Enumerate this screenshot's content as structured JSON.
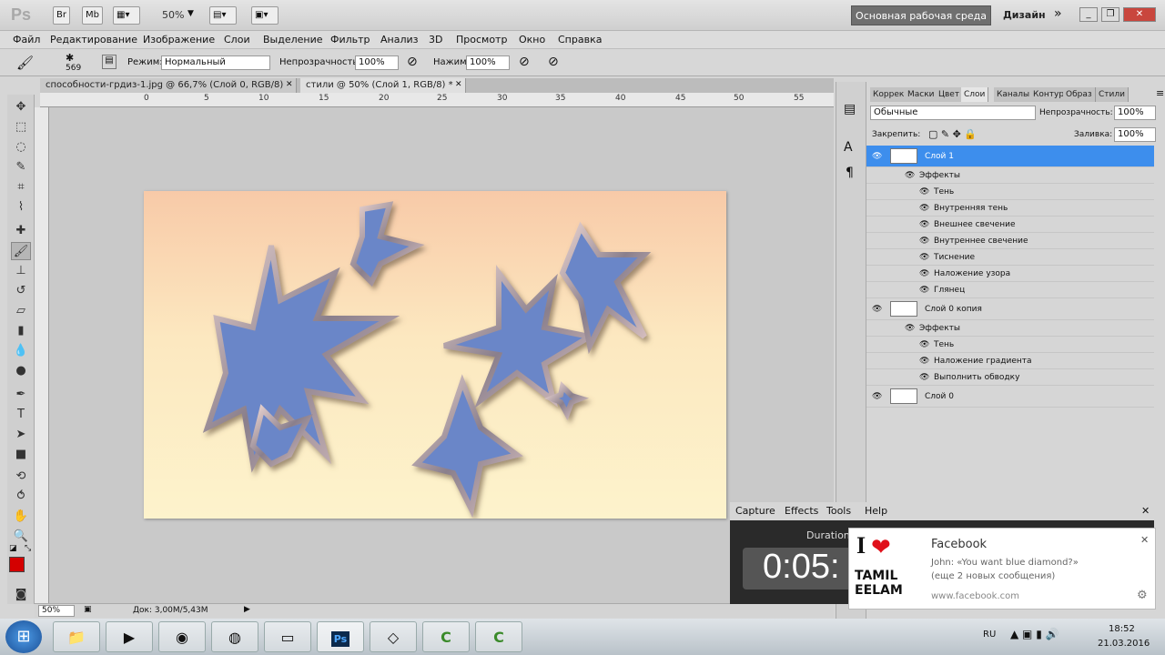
{
  "app": {
    "logo": "Ps",
    "zoom": "50%",
    "workspace": "Основная рабочая среда",
    "design": "Дизайн",
    "btn_br": "Br",
    "btn_mb": "Mb"
  },
  "menu": [
    "Файл",
    "Редактирование",
    "Изображение",
    "Слои",
    "Выделение",
    "Фильтр",
    "Анализ",
    "3D",
    "Просмотр",
    "Окно",
    "Справка"
  ],
  "options": {
    "brush_size": "569",
    "mode_label": "Режим:",
    "mode_value": "Нормальный",
    "opacity_label": "Непрозрачность:",
    "opacity_value": "100%",
    "pressure_label": "Нажим:",
    "pressure_value": "100%"
  },
  "tabs": [
    {
      "label": "способности-грдиз-1.jpg @ 66,7% (Слой 0, RGB/8) *"
    },
    {
      "label": "стили  @ 50% (Слой 1, RGB/8) *"
    }
  ],
  "ruler_h": [
    "0",
    "5",
    "10",
    "15",
    "20",
    "25",
    "30",
    "35",
    "40",
    "45",
    "50",
    "55"
  ],
  "status": {
    "zoom": "50%",
    "doc": "Док: 3,00M/5,43M"
  },
  "layers_panel": {
    "tabs": [
      "Коррек",
      "Маски",
      "Цвет",
      "Слои",
      "Каналы",
      "Контур",
      "Образ",
      "Стили"
    ],
    "blend": "Обычные",
    "opacity_label": "Непрозрачность:",
    "opacity": "100%",
    "lock_label": "Закрепить:",
    "fill_label": "Заливка:",
    "fill": "100%",
    "rows": [
      {
        "name": "Слой 1",
        "type": "layer",
        "selected": true
      },
      {
        "name": "Эффекты",
        "type": "fx-head"
      },
      {
        "name": "Тень",
        "type": "fx"
      },
      {
        "name": "Внутренняя тень",
        "type": "fx"
      },
      {
        "name": "Внешнее свечение",
        "type": "fx"
      },
      {
        "name": "Внутреннее свечение",
        "type": "fx"
      },
      {
        "name": "Тиснение",
        "type": "fx"
      },
      {
        "name": "Наложение узора",
        "type": "fx"
      },
      {
        "name": "Глянец",
        "type": "fx"
      },
      {
        "name": "Слой 0 копия",
        "type": "layer"
      },
      {
        "name": "Эффекты",
        "type": "fx-head"
      },
      {
        "name": "Тень",
        "type": "fx"
      },
      {
        "name": "Наложение градиента",
        "type": "fx"
      },
      {
        "name": "Выполнить обводку",
        "type": "fx"
      },
      {
        "name": "Слой 0",
        "type": "layer"
      }
    ]
  },
  "capture": {
    "menu": [
      "Capture",
      "Effects",
      "Tools",
      "Help"
    ],
    "duration_label": "Duration",
    "timer": "0:05:"
  },
  "notification": {
    "title": "Facebook",
    "line1": "John: «You want blue diamond?»",
    "line2": "(еще 2 новых сообщения)",
    "link": "www.facebook.com",
    "logo_top": "I",
    "logo_mid": "TAMIL",
    "logo_bot": "EELAM"
  },
  "taskbar": {
    "lang": "RU",
    "time": "18:52",
    "date": "21.03.2016",
    "apps": [
      "folder-icon",
      "media-player-icon",
      "chrome-icon",
      "firefox-icon",
      "notes-icon",
      "photoshop-icon",
      "glass-icon",
      "camtasia-icon",
      "camtasia-recorder-icon"
    ]
  },
  "colors": {
    "selected_layer": "#3d8eed",
    "fg_color": "#d40000",
    "capture_bg": "#2a2a2a"
  }
}
